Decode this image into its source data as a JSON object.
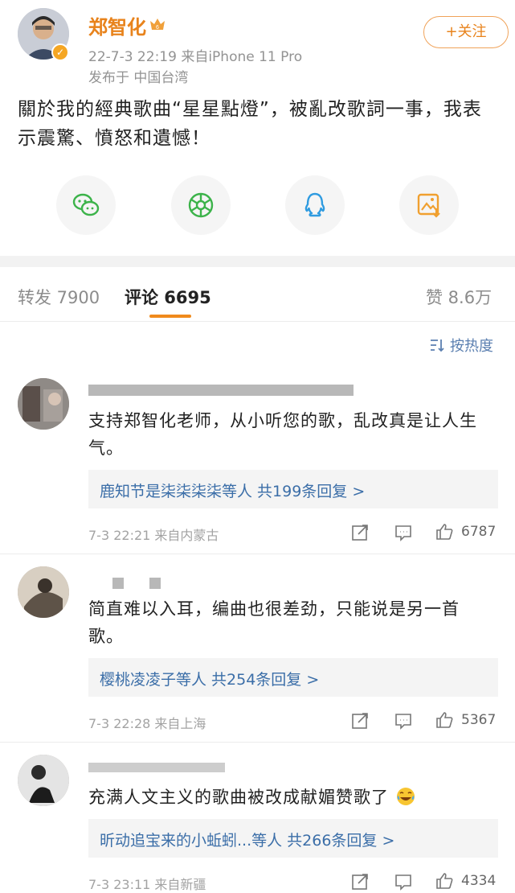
{
  "post": {
    "author": "郑智化",
    "follow_label": "+关注",
    "time_source": "22-7-3 22:19  来自iPhone 11 Pro",
    "location": "发布于 中国台湾",
    "text": "關於我的經典歌曲“星星點燈”，被亂改歌詞一事，我表示震驚、憤怒和遺憾！"
  },
  "share_icons": [
    "wechat-icon",
    "moments-icon",
    "qq-icon",
    "save-image-icon"
  ],
  "tabs": {
    "repost": "转发 7900",
    "comments": "评论 6695",
    "likes": "赞 8.6万"
  },
  "sort_label": "按热度",
  "comments": [
    {
      "text": "支持郑智化老师，从小听您的歌，乱改真是让人生气。",
      "reply": "鹿知节是柒柒柒柒等人  共199条回复 >",
      "meta": "7-3 22:21  来自内蒙古",
      "likes": "6787"
    },
    {
      "text": "简直难以入耳，编曲也很差劲，只能说是另一首歌。",
      "reply": "樱桃凌凌子等人  共254条回复 >",
      "meta": "7-3 22:28  来自上海",
      "likes": "5367"
    },
    {
      "text": "充满人文主义的歌曲被改成献媚赞歌了",
      "reply": "昕动追宝来的小蚯蚓...等人  共266条回复 >",
      "meta": "7-3 23:11  来自新疆",
      "likes": "4334"
    }
  ],
  "colors": {
    "accent": "#e8831c",
    "link": "#3b6ea8",
    "tab_underline": "#f08a1c"
  }
}
